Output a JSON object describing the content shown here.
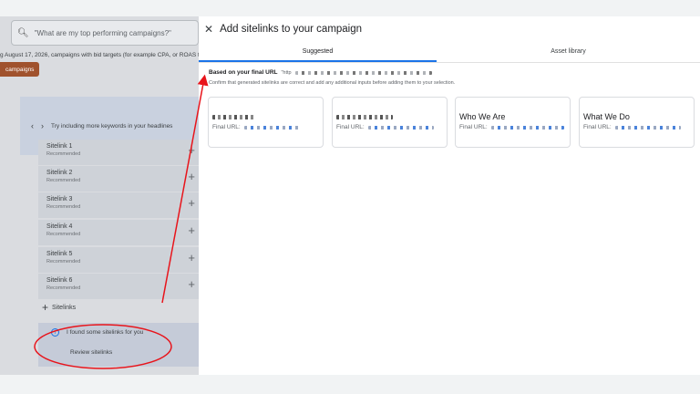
{
  "background_page": {
    "search_placeholder": "\"What are my top performing campaigns?\"",
    "notice_text": "g August 17, 2026, campaigns with bid targets (for example CPA, or ROAS ta",
    "campaigns_button": "campaigns",
    "hint_text": "Try including more keywords in your headlines",
    "sitelinks": [
      {
        "name": "Sitelink 1",
        "status": "Recommended"
      },
      {
        "name": "Sitelink 2",
        "status": "Recommended"
      },
      {
        "name": "Sitelink 3",
        "status": "Recommended"
      },
      {
        "name": "Sitelink 4",
        "status": "Recommended"
      },
      {
        "name": "Sitelink 5",
        "status": "Recommended"
      },
      {
        "name": "Sitelink 6",
        "status": "Recommended"
      }
    ],
    "add_sitelinks_label": "Sitelinks",
    "found_message": "I found some sitelinks for you",
    "review_label": "Review sitelinks"
  },
  "drawer": {
    "title": "Add sitelinks to your campaign",
    "tabs": [
      {
        "label": "Suggested",
        "active": true
      },
      {
        "label": "Asset library",
        "active": false
      }
    ],
    "based_label": "Based on your final URL",
    "based_url_prefix": "\"http",
    "confirm_text": "Confirm that generated sitelinks are correct and add any additional inputs before adding them to your selection.",
    "final_url_label": "Final URL:",
    "cards": [
      {
        "name": ""
      },
      {
        "name": ""
      },
      {
        "name": "Who We Are"
      },
      {
        "name": "What We Do"
      }
    ]
  },
  "annotation_color": "#e8141b",
  "accent_color": "#1a73e8"
}
